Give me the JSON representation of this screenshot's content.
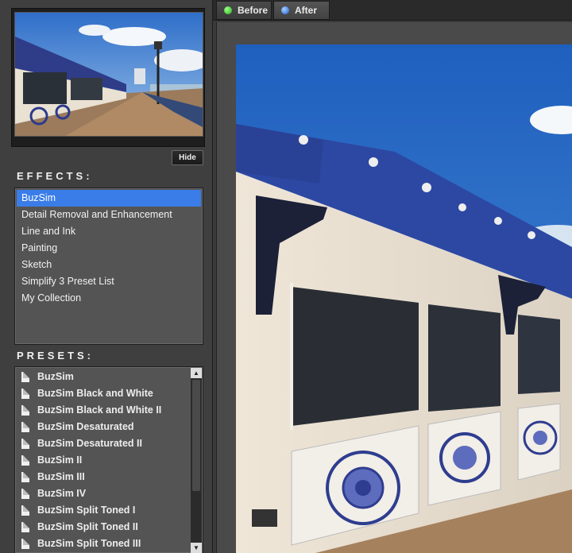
{
  "colors": {
    "accent": "#3a7de8",
    "panel": "#3f3f3f",
    "list_bg": "#545454"
  },
  "thumbnail": {
    "alt": "pier-photo"
  },
  "hide_button": {
    "label": "Hide"
  },
  "effects": {
    "title": "EFFECTS:",
    "items": [
      {
        "label": "BuzSim",
        "selected": true
      },
      {
        "label": "Detail Removal and Enhancement"
      },
      {
        "label": "Line and Ink"
      },
      {
        "label": "Painting"
      },
      {
        "label": "Sketch"
      },
      {
        "label": "Simplify 3 Preset List"
      },
      {
        "label": "My Collection"
      }
    ]
  },
  "presets": {
    "title": "PRESETS:",
    "items": [
      {
        "label": "BuzSim"
      },
      {
        "label": "BuzSim Black and White"
      },
      {
        "label": "BuzSim Black and White II"
      },
      {
        "label": "BuzSim Desaturated"
      },
      {
        "label": "BuzSim Desaturated II"
      },
      {
        "label": "BuzSim II"
      },
      {
        "label": "BuzSim III"
      },
      {
        "label": "BuzSim IV"
      },
      {
        "label": "BuzSim Split Toned I"
      },
      {
        "label": "BuzSim Split Toned II"
      },
      {
        "label": "BuzSim Split Toned III"
      }
    ]
  },
  "tabs": [
    {
      "label": "Before",
      "icon": "green-dot-icon"
    },
    {
      "label": "After",
      "icon": "blue-dot-icon"
    }
  ]
}
